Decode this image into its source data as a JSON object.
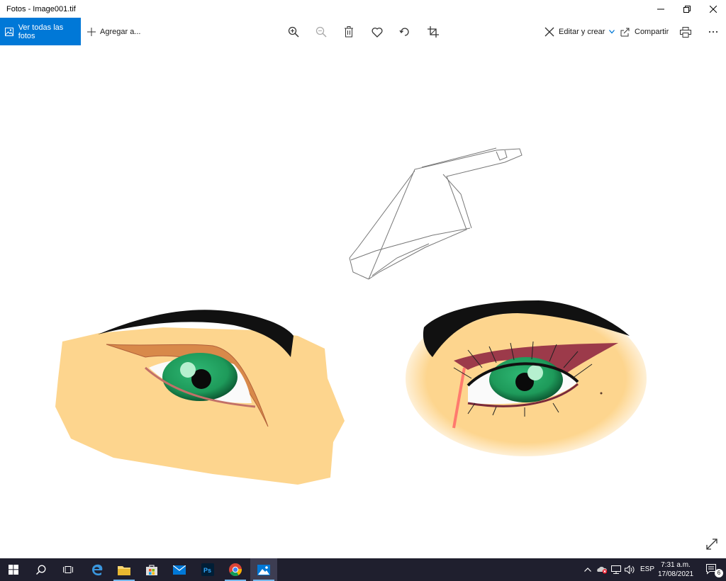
{
  "window": {
    "title": "Fotos - Image001.tif"
  },
  "toolbar": {
    "all_photos_label": "Ver todas las fotos",
    "add_to_label": "Agregar a...",
    "edit_create_label": "Editar y crear",
    "share_label": "Compartir"
  },
  "image": {
    "subject": "digital drawing of two eyes with a hand sketch",
    "accent_colors": {
      "skin": "#fdd58e",
      "iris": "#1e9a5a",
      "liner": "#c8783a"
    }
  },
  "taskbar": {
    "language": "ESP",
    "time": "7:31 a.m.",
    "date": "17/08/2021",
    "notification_count": "6"
  },
  "colors": {
    "accent": "#0078d7",
    "taskbar": "#1f1f2e"
  }
}
